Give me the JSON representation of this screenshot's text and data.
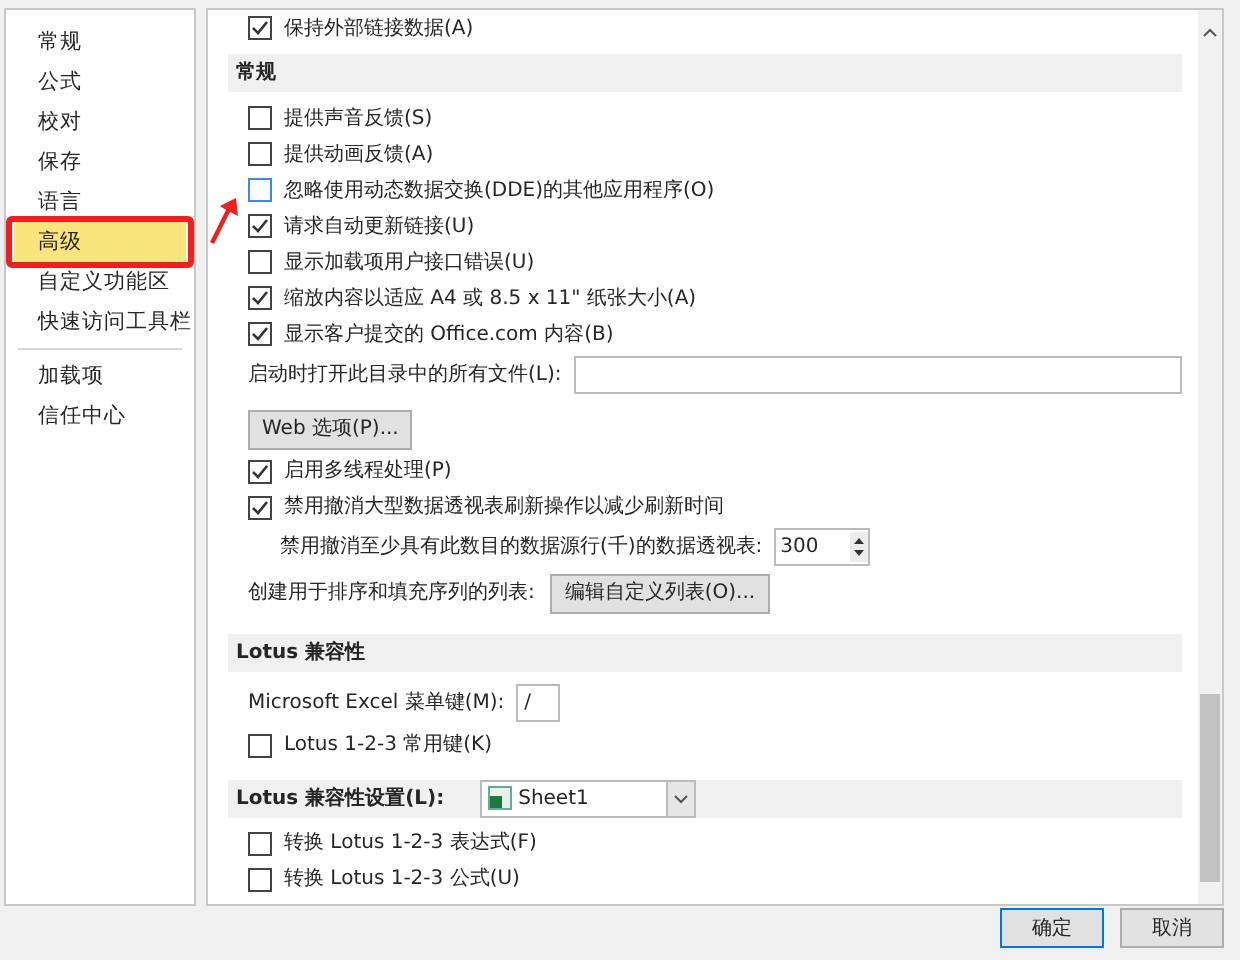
{
  "sidebar": {
    "items": [
      {
        "label": "常规",
        "selected": false
      },
      {
        "label": "公式",
        "selected": false
      },
      {
        "label": "校对",
        "selected": false
      },
      {
        "label": "保存",
        "selected": false
      },
      {
        "label": "语言",
        "selected": false
      },
      {
        "label": "高级",
        "selected": true
      },
      {
        "label": "自定义功能区",
        "selected": false
      },
      {
        "label": "快速访问工具栏",
        "selected": false
      },
      {
        "kind": "divider"
      },
      {
        "label": "加载项",
        "selected": false
      },
      {
        "label": "信任中心",
        "selected": false
      }
    ]
  },
  "top_row": {
    "label": "保持外部链接数据(A)",
    "checked": true
  },
  "sections": [
    {
      "title": "常规",
      "rows": [
        {
          "kind": "checkbox",
          "label": "提供声音反馈(S)",
          "checked": false,
          "focused": false
        },
        {
          "kind": "checkbox",
          "label": "提供动画反馈(A)",
          "checked": false,
          "focused": false
        },
        {
          "kind": "checkbox",
          "label": "忽略使用动态数据交换(DDE)的其他应用程序(O)",
          "checked": false,
          "focused": true
        },
        {
          "kind": "checkbox",
          "label": "请求自动更新链接(U)",
          "checked": true,
          "focused": false
        },
        {
          "kind": "checkbox",
          "label": "显示加载项用户接口错误(U)",
          "checked": false,
          "focused": false
        },
        {
          "kind": "checkbox",
          "label": "缩放内容以适应 A4 或 8.5 x 11\" 纸张大小(A)",
          "checked": true,
          "focused": false
        },
        {
          "kind": "checkbox",
          "label": "显示客户提交的 Office.com 内容(B)",
          "checked": true,
          "focused": false
        },
        {
          "kind": "field",
          "label": "启动时打开此目录中的所有文件(L):"
        },
        {
          "kind": "button",
          "label": "Web 选项(P)..."
        },
        {
          "kind": "checkbox",
          "label": "启用多线程处理(P)",
          "checked": true,
          "focused": false
        },
        {
          "kind": "checkbox",
          "label": "禁用撤消大型数据透视表刷新操作以减少刷新时间",
          "checked": true,
          "focused": false
        },
        {
          "kind": "spinner",
          "label": "禁用撤消至少具有此数目的数据源行(千)的数据透视表:",
          "value": "300"
        },
        {
          "kind": "label_button",
          "label": "创建用于排序和填充序列的列表:",
          "button": "编辑自定义列表(O)..."
        }
      ]
    },
    {
      "title": "Lotus 兼容性",
      "rows": [
        {
          "kind": "short_field",
          "label": "Microsoft Excel 菜单键(M):",
          "value": "/"
        },
        {
          "kind": "checkbox",
          "label": "Lotus 1-2-3 常用键(K)",
          "checked": false,
          "focused": false
        }
      ]
    },
    {
      "title": "Lotus 兼容性设置(L):",
      "dropdown": "Sheet1",
      "rows": [
        {
          "kind": "checkbox",
          "label": "转换 Lotus 1-2-3 表达式(F)",
          "checked": false,
          "focused": false
        },
        {
          "kind": "checkbox",
          "label": "转换 Lotus 1-2-3 公式(U)",
          "checked": false,
          "focused": false
        }
      ]
    }
  ],
  "buttons": [
    "确定",
    "取消"
  ]
}
